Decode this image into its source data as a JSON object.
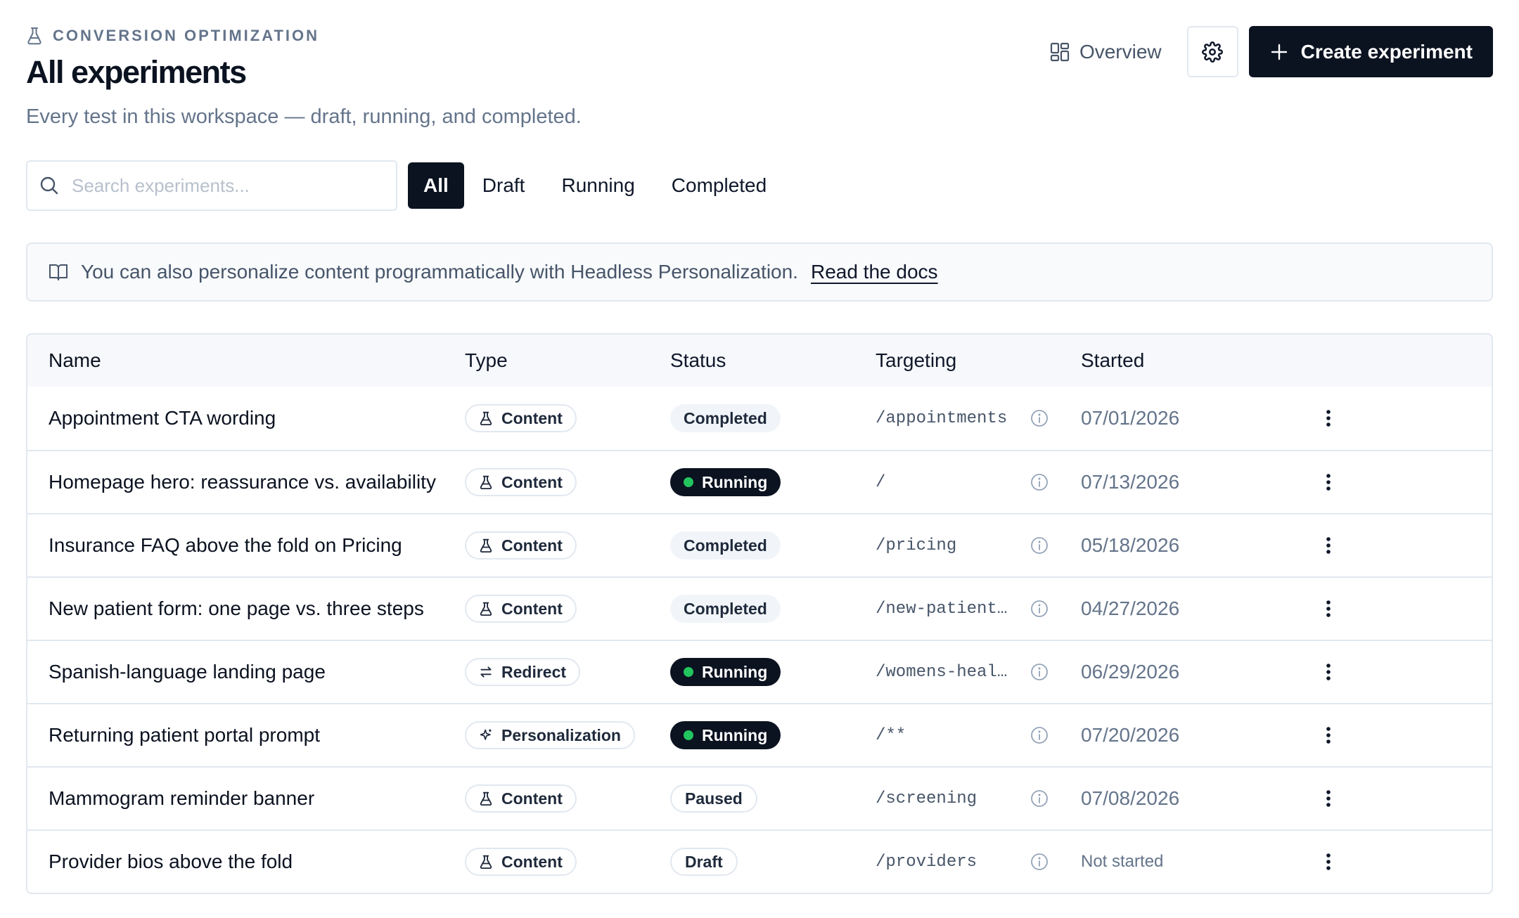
{
  "header": {
    "eyebrow": "CONVERSION OPTIMIZATION",
    "title": "All experiments",
    "subtitle": "Every test in this workspace — draft, running, and completed.",
    "overview_label": "Overview",
    "create_label": "Create experiment"
  },
  "search": {
    "placeholder": "Search experiments..."
  },
  "tabs": [
    "All",
    "Draft",
    "Running",
    "Completed"
  ],
  "active_tab": "All",
  "banner": {
    "text": "You can also personalize content programmatically with Headless Personalization.",
    "link": "Read the docs"
  },
  "table": {
    "columns": [
      "Name",
      "Type",
      "Status",
      "Targeting",
      "Started"
    ],
    "rows": [
      {
        "name": "Appointment CTA wording",
        "type": "Content",
        "type_icon": "flask-icon",
        "status": "Completed",
        "target": "/appointments",
        "started": "07/01/2026"
      },
      {
        "name": "Homepage hero: reassurance vs. availability",
        "type": "Content",
        "type_icon": "flask-icon",
        "status": "Running",
        "target": "/",
        "started": "07/13/2026"
      },
      {
        "name": "Insurance FAQ above the fold on Pricing",
        "type": "Content",
        "type_icon": "flask-icon",
        "status": "Completed",
        "target": "/pricing",
        "started": "05/18/2026"
      },
      {
        "name": "New patient form: one page vs. three steps",
        "type": "Content",
        "type_icon": "flask-icon",
        "status": "Completed",
        "target": "/new-patient/…",
        "started": "04/27/2026"
      },
      {
        "name": "Spanish-language landing page",
        "type": "Redirect",
        "type_icon": "arrows-swap-icon",
        "status": "Running",
        "target": "/womens-health",
        "started": "06/29/2026"
      },
      {
        "name": "Returning patient portal prompt",
        "type": "Personalization",
        "type_icon": "sparkle-icon",
        "status": "Running",
        "target": "/**",
        "started": "07/20/2026"
      },
      {
        "name": "Mammogram reminder banner",
        "type": "Content",
        "type_icon": "flask-icon",
        "status": "Paused",
        "target": "/screening",
        "started": "07/08/2026"
      },
      {
        "name": "Provider bios above the fold",
        "type": "Content",
        "type_icon": "flask-icon",
        "status": "Draft",
        "target": "/providers",
        "started": "Not started"
      }
    ]
  },
  "colors": {
    "primary": "#0b1220",
    "running_dot": "#22c55e",
    "muted_text": "#64748b",
    "border": "#e2e8f0"
  }
}
